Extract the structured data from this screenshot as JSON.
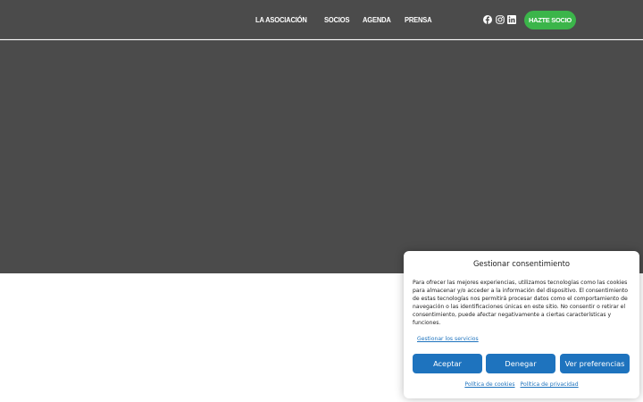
{
  "nav": {
    "items": [
      {
        "label": "LA ASOCIACIÓN"
      },
      {
        "label": "SOCIOS"
      },
      {
        "label": "AGENDA"
      },
      {
        "label": "PRENSA"
      }
    ],
    "social_icons": [
      "facebook-icon",
      "instagram-icon",
      "linkedin-icon"
    ],
    "cta_label": "HAZTE SOCIO"
  },
  "colors": {
    "header_bg": "#4b4b4b",
    "cta_bg": "#3bb54a",
    "consent_button": "#1e73be",
    "link": "#1e73be"
  },
  "consent": {
    "title": "Gestionar consentimiento",
    "body": "Para ofrecer las mejores experiencias, utilizamos tecnologías como las cookies para almacenar y/o acceder a la información del dispositivo. El consentimiento de estas tecnologías nos permitirá procesar datos como el comportamiento de navegación o las identificaciones únicas en este sitio. No consentir o retirar el consentimiento, puede afectar negativamente a ciertas características y funciones.",
    "manage_link": "Gestionar los servicios",
    "accept_label": "Aceptar",
    "deny_label": "Denegar",
    "prefs_label": "Ver preferencias",
    "cookie_policy": "Política de cookies",
    "privacy_policy": "Política de privacidad"
  }
}
